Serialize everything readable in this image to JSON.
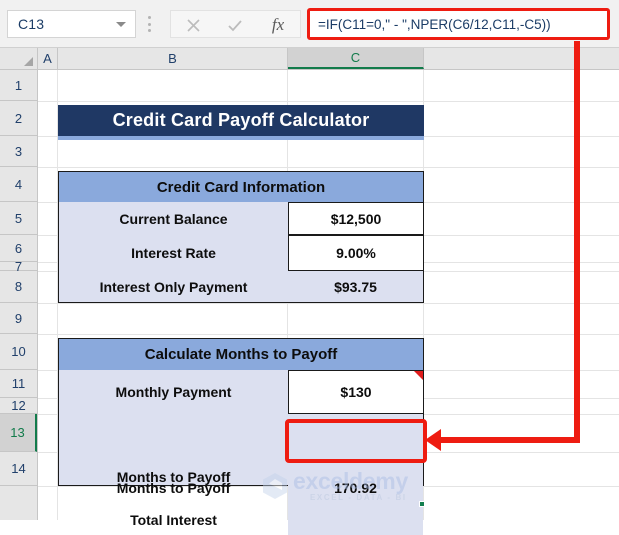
{
  "formula_bar": {
    "name_box_value": "C13",
    "name_box_icon": "chevron-down-icon",
    "cancel_icon": "close-icon",
    "enter_icon": "check-icon",
    "function_icon": "fx-icon",
    "formula_text": "=IF(C11=0,\" - \",NPER(C6/12,C11,-C5))"
  },
  "grid": {
    "columns": [
      "A",
      "B",
      "C"
    ],
    "selected_column": "C",
    "rows": [
      "1",
      "2",
      "3",
      "4",
      "5",
      "6",
      "7",
      "8",
      "9",
      "10",
      "11",
      "12",
      "13",
      "14"
    ],
    "selected_row": "13"
  },
  "sheet": {
    "title": "Credit Card Payoff Calculator",
    "sections": [
      {
        "header": "Credit Card Information",
        "rows": [
          {
            "label": "Current Balance",
            "value": "$12,500",
            "kind": "input"
          },
          {
            "label": "Interest Rate",
            "value": "9.00%",
            "kind": "input"
          },
          {
            "label": "Interest Only Payment",
            "value": "$93.75",
            "kind": "calc"
          }
        ]
      },
      {
        "header": "Calculate Months to Payoff",
        "rows": [
          {
            "label": "Monthly Payment",
            "value": "$130",
            "kind": "input"
          },
          {
            "label": "Months to Payoff",
            "value": "170.92",
            "kind": "calc"
          },
          {
            "label": "Total Interest",
            "value": "",
            "kind": "calc"
          }
        ]
      }
    ]
  },
  "annotation": {
    "color": "#ee1c11",
    "target_cell": "C13",
    "arrow_icon": "arrow-left-icon"
  },
  "watermark": {
    "name": "exceldemy",
    "tagline": "EXCEL - DATA - BI"
  },
  "colors": {
    "title_navy": "#1f3864",
    "header_blue": "#8aa9dc",
    "body_lavender": "#dce0f0",
    "annotation_red": "#ee1c11",
    "selection_green": "#137e4e"
  }
}
